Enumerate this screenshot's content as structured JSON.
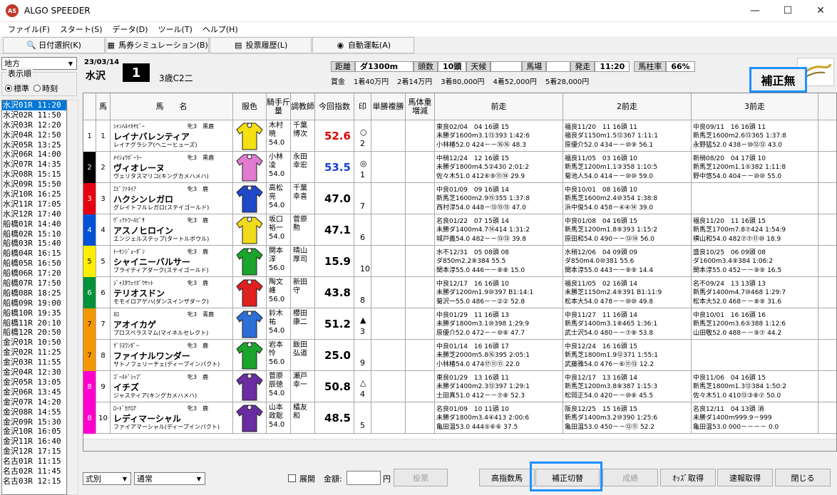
{
  "app": {
    "title": "ALGO SPEEDER",
    "icon_label": "AS"
  },
  "window_controls": {
    "minimize": "—",
    "maximize": "☐",
    "close": "✕"
  },
  "menu": [
    "ファイル(F)",
    "スタート(S)",
    "データ(D)",
    "ツール(T)",
    "ヘルプ(H)"
  ],
  "toolbar": [
    {
      "label": "日付選択(K)",
      "icon": "search-icon"
    },
    {
      "label": "馬券シミュレーション(B)",
      "icon": "table-icon"
    },
    {
      "label": "投票履歴(L)",
      "icon": "document-icon"
    },
    {
      "label": "自動運転(A)",
      "icon": "play-icon"
    }
  ],
  "left": {
    "region": "地方",
    "sort_label": "表示順",
    "sort_options": [
      "標準",
      "時刻"
    ],
    "sort_selected": 0,
    "races": [
      "水沢01R 11:20",
      "水沢02R 11:50",
      "水沢03R 12:20",
      "水沢04R 12:50",
      "水沢05R 13:25",
      "水沢06R 14:00",
      "水沢07R 14:35",
      "水沢08R 15:15",
      "水沢09R 15:50",
      "水沢10R 16:25",
      "水沢11R 17:05",
      "水沢12R 17:40",
      "船橋01R 14:40",
      "船橋02R 15:10",
      "船橋03R 15:40",
      "船橋04R 16:15",
      "船橋05R 16:50",
      "船橋06R 17:20",
      "船橋07R 17:50",
      "船橋08R 18:25",
      "船橋09R 19:00",
      "船橋10R 19:35",
      "船橋11R 20:10",
      "船橋12R 20:50",
      "金沢01R 10:50",
      "金沢02R 11:25",
      "金沢03R 11:55",
      "金沢04R 12:30",
      "金沢05R 13:05",
      "金沢06R 13:45",
      "金沢07R 14:20",
      "金沢08R 14:55",
      "金沢09R 15:30",
      "金沢10R 16:05",
      "金沢11R 16:40",
      "金沢12R 17:15",
      "名古01R 11:15",
      "名古02R 11:45",
      "名古03R 12:15"
    ],
    "selected_race": 0
  },
  "header": {
    "date": "23/03/14",
    "venue": "水沢",
    "race_no": "1",
    "race_class": "3歳C2二",
    "info": [
      {
        "label": "距離",
        "value": "ダ1300m"
      },
      {
        "label": "頭数",
        "value": "10頭"
      },
      {
        "label": "天候",
        "value": ""
      },
      {
        "label": "馬場",
        "value": ""
      },
      {
        "label": "発走",
        "value": "11:20"
      },
      {
        "label": "馬柱率",
        "value": "66%"
      }
    ],
    "prize": [
      "賞金",
      "1着40万円",
      "2着14万円",
      "3着80,000円",
      "4着52,000円",
      "5着28,000円"
    ],
    "correction_status": "補正無"
  },
  "columns": {
    "ban": "馬",
    "name": "馬　　名",
    "silk": "服色",
    "jockey": "騎手斤量",
    "trainer": "調教師",
    "index": "今回指数",
    "mark": "印",
    "odds": "単勝複勝",
    "weight": "馬体重増減",
    "past1": "前走",
    "past2": "2前走",
    "past3": "3前走"
  },
  "horses": [
    {
      "waku": "1",
      "wc": "#ffffff",
      "wt": "#000",
      "no": "1",
      "sire": "ｼｬﾝﾊﾙｲｷﾔﾋﾞｰ",
      "sa": "牝3　黒鹿",
      "name": "レイナバレンティア",
      "dam": "レイナグラシア(ヘニーヒューズ)",
      "jockey": [
        "木村",
        "暁",
        "54.0"
      ],
      "trainer": [
        "千葉",
        "博次"
      ],
      "index": "52.6",
      "ic": "#e00000",
      "mark": "○",
      "pop": "2",
      "silk": "#f5e012",
      "p": [
        [
          "東良02/04　04 16頭 15",
          "未勝ダ1600m3.1⑬393 1:42:6",
          "小林椿52.0 424－－⑯⑯ 48.3"
        ],
        [
          "福良11/20　11 16頭 11",
          "福良ダ1150m1.5⑫367 1:11:1",
          "原優介52.0 434－－⑩⑨ 56.1"
        ],
        [
          "中良09/11　16 16頭 11",
          "新馬芝1600m2.6⑬365 1:37:8",
          "永野猛52.0 438－⑩⑫⑫ 43.0"
        ]
      ]
    },
    {
      "waku": "2",
      "wc": "#000000",
      "wt": "#fff",
      "no": "2",
      "sire": "ﾒｲｼｮｳﾎﾞｰﾗｰ",
      "sa": "牝3　黒鹿",
      "name": "ヴィオレーヌ",
      "dam": "ヴェリタスマリコ(キングカメハメハ)",
      "jockey": [
        "小林",
        "凌",
        "54.0"
      ],
      "trainer": [
        "永田",
        "幸宏"
      ],
      "index": "53.5",
      "ic": "#1a3fd1",
      "mark": "◎",
      "pop": "1",
      "silk": "#e27ad1",
      "p": [
        [
          "中稍12/24　12 16頭 15",
          "未勝ダ1800m4.5②430 2:01:2",
          "佐々木51.0 412⑥⑨⑪⑭ 29.9"
        ],
        [
          "福良11/05　03 16頭 10",
          "新馬芝1200m1.1③358 1:10:5",
          "菊池人54.0 414－－⑩⑩ 59.0"
        ],
        [
          "新稍08/20　04 17頭 10",
          "新馬芝1200m1.1⑤382 1:11:8",
          "野中悠54.0 404－－⑩⑩ 55.0"
        ]
      ]
    },
    {
      "waku": "3",
      "wc": "#e60012",
      "wt": "#fff",
      "no": "3",
      "sire": "ｴﾋﾟﾌｧﾈｲｱ",
      "sa": "牝3　鹿",
      "name": "ハクシンレガロ",
      "dam": "グレイトフルレガロ(ステイゴールド)",
      "jockey": [
        "高松",
        "亮",
        "54.0"
      ],
      "trainer": [
        "千葉",
        "幸喜"
      ],
      "index": "47.0",
      "ic": "#000000",
      "mark": "",
      "pop": "7",
      "silk": "#1f49c9",
      "p": [
        [
          "中良01/09　09 16頭 14",
          "新馬芝1600m2.9⑮355 1:37:8",
          "西村淳54.0 448－⑬⑮⑮ 47.0"
        ],
        [
          "中良10/01　08 16頭 10",
          "新馬芝1600m2.4⑩354 1:38:8",
          "浜中俊54.0 458－④④⑭ 39.0"
        ],
        [
          "",
          "",
          ""
        ]
      ]
    },
    {
      "waku": "4",
      "wc": "#0050d8",
      "wt": "#fff",
      "no": "4",
      "sire": "ｳﾞｨｸﾄﾜｰﾙﾋﾟｻ",
      "sa": "牝3　鹿",
      "name": "アスノヒロイン",
      "dam": "エンジェルステップ(タートルボウル)",
      "jockey": [
        "坂口",
        "裕一",
        "54.0"
      ],
      "trainer": [
        "菅原",
        "勲"
      ],
      "index": "47.1",
      "ic": "#000000",
      "mark": "",
      "pop": "6",
      "silk": "#f1da1b",
      "p": [
        [
          "名良01/22　07 15頭 14",
          "未勝ダ1400m4.7⑭414 1:31:2",
          "城戸義54.0 482－－⑬⑬ 39.8"
        ],
        [
          "中良01/08　04 16頭 15",
          "新馬芝1200m1.8⑨393 1:15:2",
          "原田和54.0 490－－⑬⑭ 56.0"
        ],
        [
          "福良11/20　11 16頭 15",
          "新馬芝1700m7.8⑦424 1:54:9",
          "横山和54.0 482⑦⑦⑪⑩ 18.9"
        ]
      ]
    },
    {
      "waku": "5",
      "wc": "#ffee00",
      "wt": "#000",
      "no": "5",
      "sire": "ﾄｰｾﾝｼﾞｮｰﾀﾞﾝ",
      "sa": "牝3　鹿",
      "name": "シャイニーバルサー",
      "dam": "ブライティアダーク(ステイゴールド)",
      "jockey": [
        "関本",
        "淳",
        "56.0"
      ],
      "trainer": [
        "晴山",
        "厚司"
      ],
      "index": "15.9",
      "ic": "#000000",
      "mark": "",
      "pop": "10",
      "silk": "#1aa52c",
      "p": [
        [
          "水不12/31　05 08頭 08",
          "ダ850m2.2⑧384 55.5",
          "関本淳55.0 446－－⑧⑧ 15.0"
        ],
        [
          "水稍12/06　04 09頭 09",
          "ダ850m4.0⑩381 55.6",
          "関本淳55.0 443－－⑨⑨ 14.4"
        ],
        [
          "盛良10/25　06 09頭 08",
          "ダ1600m3.4⑨384 1:06:2",
          "関本淳55.0 452－－⑨⑨ 16.5"
        ]
      ]
    },
    {
      "waku": "6",
      "wc": "#00913a",
      "wt": "#fff",
      "no": "6",
      "sire": "ｼﾞｬｽﾀｳｪｲﾎﾞｳﾔｯﾄ",
      "sa": "牝3　鹿",
      "name": "テリオスドン",
      "dam": "モモイロアゲハ(ダンスインザダーク)",
      "jockey": [
        "陶文",
        "峰",
        "56.0"
      ],
      "trainer": [
        "新田",
        "守"
      ],
      "index": "43.8",
      "ic": "#000000",
      "mark": "",
      "pop": "8",
      "silk": "#e01f1f",
      "p": [
        [
          "中良12/17　16 16頭 10",
          "未勝ダ1200m1.9⑩397 B1:14:1",
          "菊沢一55.0 486－－②② 52.8"
        ],
        [
          "福良11/05　02 16頭 14",
          "未勝芝1150m2.4⑨391 B1:11:9",
          "松本大54.0 478－－⑩⑩ 49.8"
        ],
        [
          "名不09/24　13 13頭 13",
          "新馬ダ1400m4.7⑩468 1:29:7",
          "松本大52.0 468－－⑧⑨ 31.6"
        ]
      ]
    },
    {
      "waku": "7",
      "wc": "#f39800",
      "wt": "#000",
      "no": "7",
      "sire": "ﾈﾛ",
      "sa": "牝3　青鹿",
      "name": "アオイカゲ",
      "dam": "プロスペラスマム(マイネルセレクト)",
      "jockey": [
        "鈴木",
        "祐",
        "54.0"
      ],
      "trainer": [
        "櫻田",
        "康二"
      ],
      "index": "51.2",
      "ic": "#000000",
      "mark": "▲",
      "pop": "3",
      "silk": "#2e6fd6",
      "p": [
        [
          "中良01/29　11 16頭 13",
          "未勝ダ1800m3.1⑩398 1:29:9",
          "原優介52.0 472－－⑩⑧ 47.7"
        ],
        [
          "中良11/27　11 16頭 14",
          "新馬ダ1400m3.1⑧465 1:36:1",
          "武士沢54.0 480－－⑦⑧ 53.8"
        ],
        [
          "中良10/01　16 16頭 16",
          "新馬芝1200m3.6⑤388 1:12:6",
          "山田敬52.0 488－－⑨⑦ 44.2"
        ]
      ]
    },
    {
      "waku": "7",
      "wc": "#f39800",
      "wt": "#000",
      "no": "8",
      "sire": "ｸﾞﾗｽﾜﾝﾀﾞｰ",
      "sa": "牝3　鹿",
      "name": "ファイナルワンダー",
      "dam": "サトノフェリーチェ(ディープインパクト)",
      "jockey": [
        "岩本",
        "怜",
        "56.0"
      ],
      "trainer": [
        "飯田",
        "弘道"
      ],
      "index": "25.0",
      "ic": "#000000",
      "mark": "",
      "pop": "9",
      "silk": "#1aa52c",
      "p": [
        [
          "中良01/14　16 16頭 17",
          "未勝芝2000m5.8⑯395 2:05:1",
          "小林椿54.0 474⑰⑪⑪ 22.0"
        ],
        [
          "中良12/24　16 16頭 15",
          "新馬芝1800m1.9⑫371 1:55:1",
          "武藤雅54.0 476－⑥⑪⑬ 12.2"
        ],
        [
          "",
          "",
          ""
        ]
      ]
    },
    {
      "waku": "8",
      "wc": "#ff00cc",
      "wt": "#fff",
      "no": "9",
      "sire": "ｺﾞｰﾙﾄﾞｼｯﾌﾟ",
      "sa": "牝3　鹿",
      "name": "イチズ",
      "dam": "ジャスティア(キングカメハメハ)",
      "jockey": [
        "菅原",
        "辰徳",
        "54.0"
      ],
      "trainer": [
        "瀬戸",
        "幸一"
      ],
      "index": "50.8",
      "ic": "#000000",
      "mark": "△",
      "pop": "4",
      "silk": "#6a2da1",
      "p": [
        [
          "東良01/29　13 16頭 11",
          "未勝ダ1400m2.3⑫397 1:29:1",
          "土田真51.0 412－－⑦⑧ 52.3"
        ],
        [
          "中良12/17　13 16頭 14",
          "新馬芝1200m3.8⑧387 1:15:3",
          "松岡正54.0 420－－⑩⑧ 45.5"
        ],
        [
          "中良11/06　04 16頭 15",
          "新馬芝1800m1.3⑫384 1:50:2",
          "佐々木51.0 410⑬③⑧⑦ 50.0"
        ]
      ]
    },
    {
      "waku": "8",
      "wc": "#ff00cc",
      "wt": "#fff",
      "no": "10",
      "sire": "ﾛｰﾄﾞｶﾅﾛｱ",
      "sa": "牝3　鹿",
      "name": "レディマーシャル",
      "dam": "ファイアマーシャル(ディープインパクト)",
      "jockey": [
        "山本",
        "政聡",
        "54.0"
      ],
      "trainer": [
        "橘友",
        "和"
      ],
      "index": "48.5",
      "ic": "#000000",
      "mark": "",
      "pop": "5",
      "silk": "#6a2da1",
      "p": [
        [
          "名良01/09　10 11頭 10",
          "未勝ダ1800m3.4④413 2:00:6",
          "亀田温53.0 444⑤⑥⑥ 37.5"
        ],
        [
          "阪良12/25　15 16頭 15",
          "新馬ダ1400m3.2⑩390 1:25:6",
          "亀田温53.0 450－－⑫⑪ 52.2"
        ],
        [
          "名良12/11　04 13頭 消",
          "未勝ダ1400m999.9－999",
          "亀田温53.0 000－－－－ 0.0"
        ]
      ]
    }
  ],
  "bottom": {
    "bet_type": "式別",
    "bet_mode": "通常",
    "expand_label": "展開",
    "amount_label": "金額:",
    "yen": "円",
    "vote_button": "投票",
    "high_index_button": "高指数馬",
    "correction_toggle_button": "補正切替",
    "result_button": "成績",
    "odds_button": "ｵｯｽﾞ取得",
    "fast_result_button": "速報取得",
    "close_button": "閉じる"
  },
  "colors": {
    "highlight": "#1e90ff",
    "selected_race": "#0078d7"
  }
}
